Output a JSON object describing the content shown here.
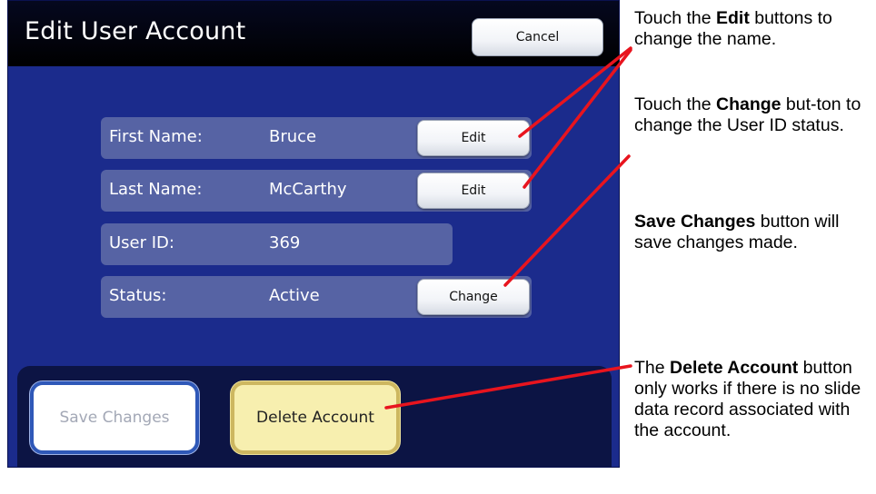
{
  "screen": {
    "title": "Edit User Account",
    "cancel_label": "Cancel",
    "fields": [
      {
        "label": "First Name:",
        "value": "Bruce",
        "button": "Edit"
      },
      {
        "label": "Last Name:",
        "value": "McCarthy",
        "button": "Edit"
      },
      {
        "label": "User ID:",
        "value": "369"
      },
      {
        "label": "Status:",
        "value": "Active",
        "button": "Change"
      }
    ],
    "save_label": "Save Changes",
    "delete_label": "Delete Account"
  },
  "annotations": {
    "edit": {
      "pre": "Touch the ",
      "bold": "Edit",
      "post": " buttons to change the name."
    },
    "change": {
      "pre": "Touch the ",
      "bold": "Change",
      "post": " but-ton to change the User ID status."
    },
    "save": {
      "pre": "",
      "bold": "Save Changes",
      "post": " button will save changes made."
    },
    "delete": {
      "pre": "The ",
      "bold": "Delete Account",
      "post": " button only works if there is no slide data record associated with the account."
    }
  },
  "colors": {
    "screen_bg": "#1b2b8c",
    "field_bg": "#5663a4",
    "callout_line": "#e8141e",
    "delete_bg": "#f7efaf"
  }
}
